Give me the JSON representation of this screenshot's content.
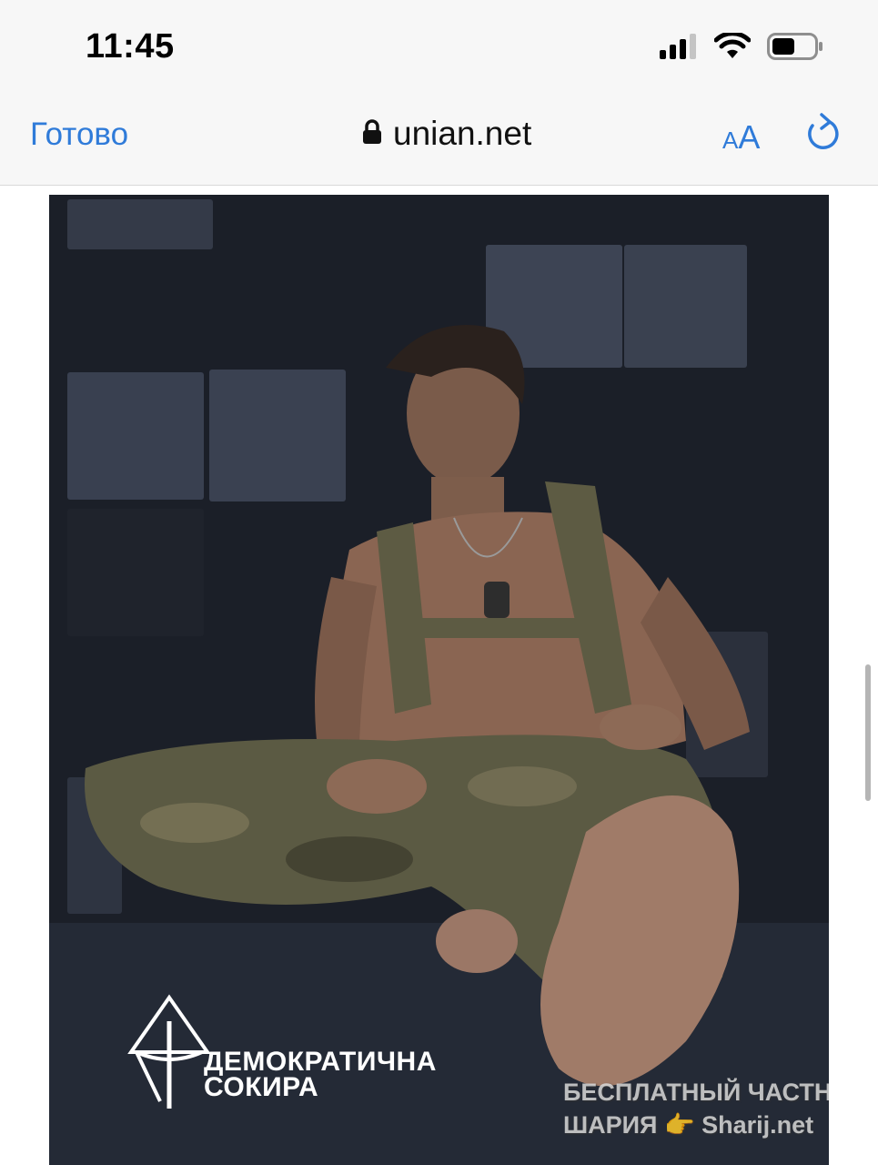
{
  "status_bar": {
    "time": "11:45",
    "icons": [
      "cellular-signal-icon",
      "wifi-icon",
      "battery-icon"
    ]
  },
  "toolbar": {
    "done_label": "Готово",
    "url": "unian.net",
    "text_size_label_small": "A",
    "text_size_label_big": "A",
    "icons": [
      "lock-icon",
      "reload-icon"
    ],
    "accent_color": "#2f7bd9"
  },
  "article_image": {
    "logo_text_line1": "ДЕМОКРАТИЧНА",
    "logo_text_line2": "СОКИРА",
    "watermark_line1": "БЕСПЛАТНЫЙ ЧАСТНЫЙ",
    "watermark_line2": "ШАРИЯ",
    "watermark_line2_site": "Sharij.net",
    "watermark_icon": "pointing-hand-icon"
  }
}
